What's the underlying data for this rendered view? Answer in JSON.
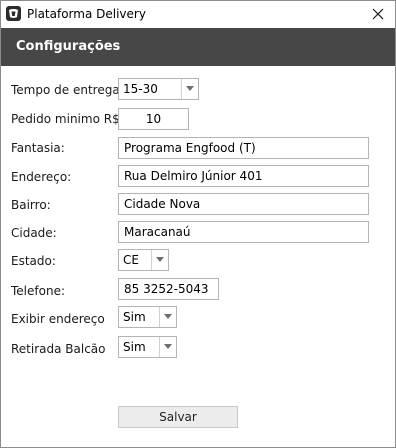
{
  "window": {
    "title": "Plataforma Delivery",
    "icon": "app-logo-icon",
    "close_icon": "close-icon"
  },
  "header": {
    "title": "Configurações"
  },
  "form": {
    "tempo_entrega": {
      "label": "Tempo de entrega",
      "value": "15-30"
    },
    "pedido_minimo": {
      "label": "Pedido minimo R$",
      "value": "10"
    },
    "fantasia": {
      "label": "Fantasia:",
      "value": "Programa Engfood (T)"
    },
    "endereco": {
      "label": "Endereço:",
      "value": "Rua Delmiro Júnior 401"
    },
    "bairro": {
      "label": "Bairro:",
      "value": "Cidade Nova"
    },
    "cidade": {
      "label": "Cidade:",
      "value": "Maracanaú"
    },
    "estado": {
      "label": "Estado:",
      "value": "CE"
    },
    "telefone": {
      "label": "Telefone:",
      "value": "85 3252-5043"
    },
    "exibir_endereco": {
      "label": "Exibir endereço",
      "value": "Sim"
    },
    "retirada_balcao": {
      "label": "Retirada Balcão",
      "value": "Sim"
    }
  },
  "actions": {
    "save_label": "Salvar"
  },
  "colors": {
    "header_band": "#474747",
    "border": "#b4b4b4",
    "button_bg": "#ececec"
  }
}
